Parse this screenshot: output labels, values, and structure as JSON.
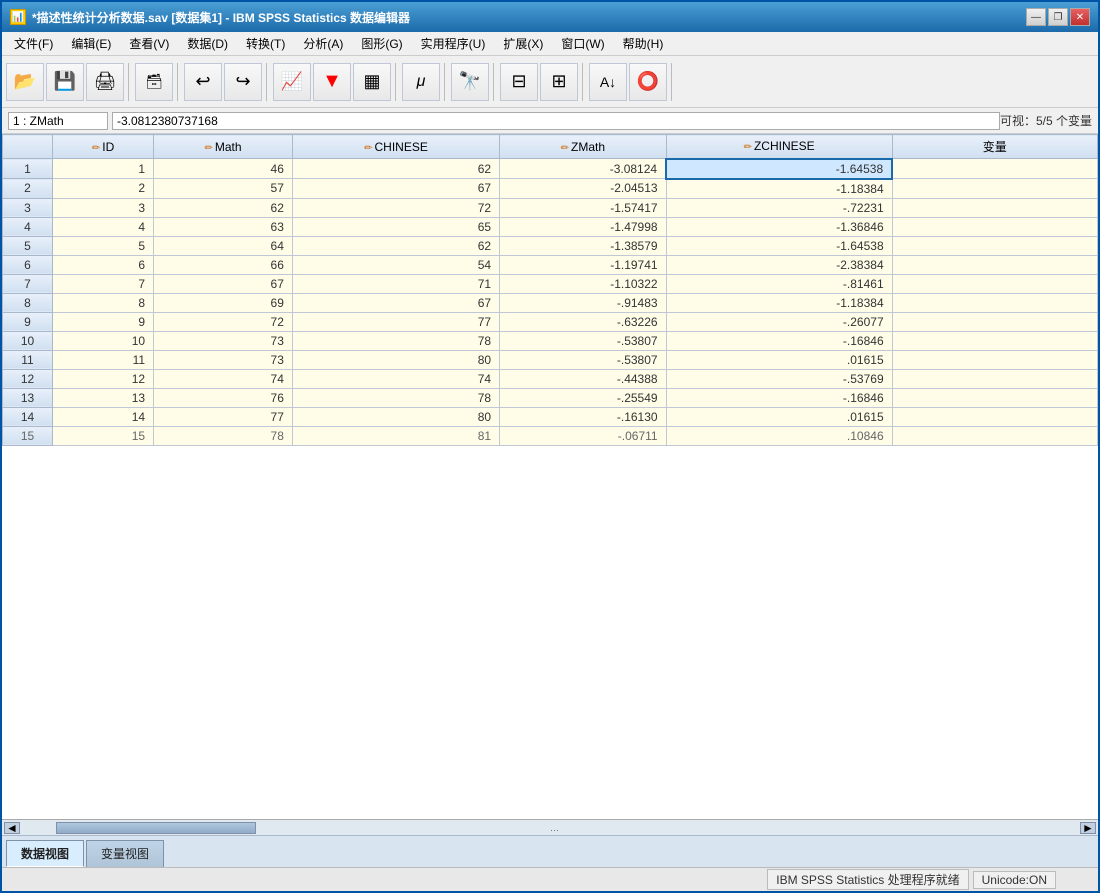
{
  "window": {
    "title": "*描述性统计分析数据.sav [数据集1] - IBM SPSS Statistics 数据编辑器"
  },
  "menu": {
    "items": [
      "文件(F)",
      "编辑(E)",
      "查看(V)",
      "数据(D)",
      "转换(T)",
      "分析(A)",
      "图形(G)",
      "实用程序(U)",
      "扩展(X)",
      "窗口(W)",
      "帮助(H)"
    ]
  },
  "formula_bar": {
    "cell_ref": "1 : ZMath",
    "value": "-3.0812380737168",
    "visible": "可视：5/5 个变量"
  },
  "columns": [
    {
      "name": "ID",
      "icon": "✏"
    },
    {
      "name": "Math",
      "icon": "✏"
    },
    {
      "name": "CHINESE",
      "icon": "✏"
    },
    {
      "name": "ZMath",
      "icon": "✏"
    },
    {
      "name": "ZCHINESE",
      "icon": "✏"
    },
    {
      "name": "变量",
      "icon": ""
    }
  ],
  "rows": [
    {
      "row": 1,
      "id": 1,
      "math": 46,
      "chinese": 62,
      "zmath": "-3.08124",
      "zchinese": "-1.64538",
      "selected_zmath": true
    },
    {
      "row": 2,
      "id": 2,
      "math": 57,
      "chinese": 67,
      "zmath": "-2.04513",
      "zchinese": "-1.18384"
    },
    {
      "row": 3,
      "id": 3,
      "math": 62,
      "chinese": 72,
      "zmath": "-1.57417",
      "zchinese": "-.72231"
    },
    {
      "row": 4,
      "id": 4,
      "math": 63,
      "chinese": 65,
      "zmath": "-1.47998",
      "zchinese": "-1.36846"
    },
    {
      "row": 5,
      "id": 5,
      "math": 64,
      "chinese": 62,
      "zmath": "-1.38579",
      "zchinese": "-1.64538"
    },
    {
      "row": 6,
      "id": 6,
      "math": 66,
      "chinese": 54,
      "zmath": "-1.19741",
      "zchinese": "-2.38384"
    },
    {
      "row": 7,
      "id": 7,
      "math": 67,
      "chinese": 71,
      "zmath": "-1.10322",
      "zchinese": "-.81461"
    },
    {
      "row": 8,
      "id": 8,
      "math": 69,
      "chinese": 67,
      "zmath": "-.91483",
      "zchinese": "-1.18384"
    },
    {
      "row": 9,
      "id": 9,
      "math": 72,
      "chinese": 77,
      "zmath": "-.63226",
      "zchinese": "-.26077"
    },
    {
      "row": 10,
      "id": 10,
      "math": 73,
      "chinese": 78,
      "zmath": "-.53807",
      "zchinese": "-.16846"
    },
    {
      "row": 11,
      "id": 11,
      "math": 73,
      "chinese": 80,
      "zmath": "-.53807",
      "zchinese": ".01615"
    },
    {
      "row": 12,
      "id": 12,
      "math": 74,
      "chinese": 74,
      "zmath": "-.44388",
      "zchinese": "-.53769"
    },
    {
      "row": 13,
      "id": 13,
      "math": 76,
      "chinese": 78,
      "zmath": "-.25549",
      "zchinese": "-.16846"
    },
    {
      "row": 14,
      "id": 14,
      "math": 77,
      "chinese": 80,
      "zmath": "-.16130",
      "zchinese": ".01615"
    },
    {
      "row": 15,
      "id": 15,
      "math": 78,
      "chinese": 81,
      "zmath": "-.06711",
      "zchinese": ".10846"
    }
  ],
  "tabs": [
    {
      "label": "数据视图",
      "active": true
    },
    {
      "label": "变量视图",
      "active": false
    }
  ],
  "status": {
    "message": "IBM SPSS Statistics 处理程序就绪",
    "encoding": "Unicode:ON"
  },
  "title_controls": {
    "minimize": "—",
    "restore": "❐",
    "close": "✕"
  }
}
